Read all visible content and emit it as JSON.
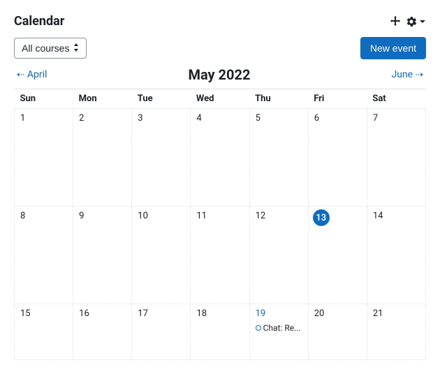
{
  "header": {
    "title": "Calendar"
  },
  "toolbar": {
    "course_filter": "All courses",
    "new_event": "New event"
  },
  "nav": {
    "prev": "April",
    "current": "May 2022",
    "next": "June"
  },
  "weekdays": [
    "Sun",
    "Mon",
    "Tue",
    "Wed",
    "Thu",
    "Fri",
    "Sat"
  ],
  "weeks": [
    [
      {
        "n": "1"
      },
      {
        "n": "2"
      },
      {
        "n": "3"
      },
      {
        "n": "4"
      },
      {
        "n": "5"
      },
      {
        "n": "6"
      },
      {
        "n": "7"
      }
    ],
    [
      {
        "n": "8"
      },
      {
        "n": "9"
      },
      {
        "n": "10"
      },
      {
        "n": "11"
      },
      {
        "n": "12"
      },
      {
        "n": "13",
        "today": true
      },
      {
        "n": "14"
      }
    ],
    [
      {
        "n": "15"
      },
      {
        "n": "16"
      },
      {
        "n": "17"
      },
      {
        "n": "18"
      },
      {
        "n": "19",
        "event": "Chat: Re..."
      },
      {
        "n": "20"
      },
      {
        "n": "21"
      }
    ]
  ]
}
